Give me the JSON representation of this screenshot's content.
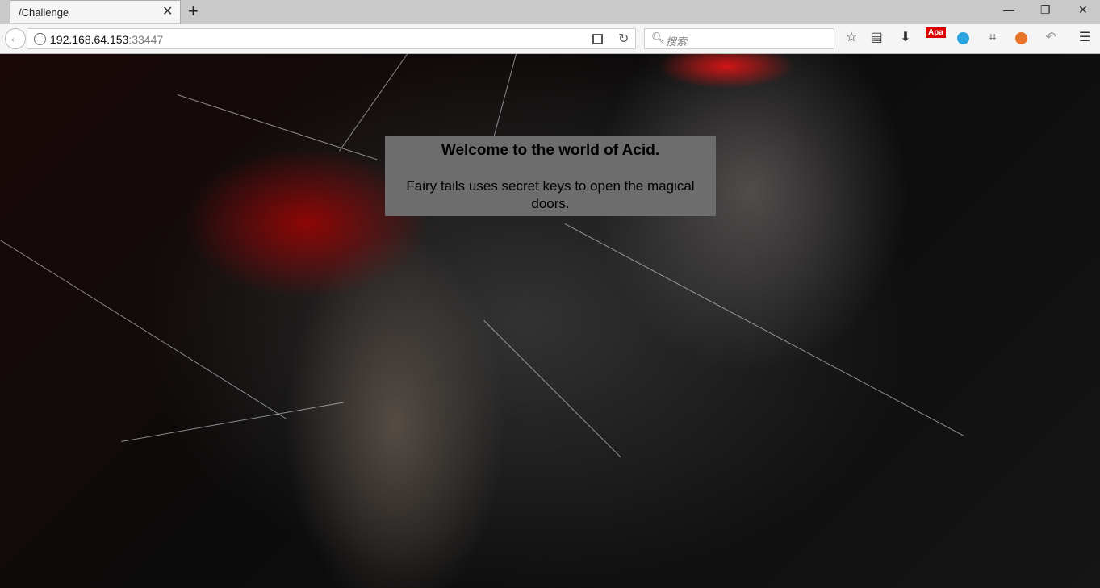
{
  "browser": {
    "tab": {
      "title": "/Challenge"
    },
    "address": {
      "host": "192.168.64.153",
      "port": ":33447"
    },
    "search": {
      "placeholder": "搜索"
    },
    "extension_badge": "Apa"
  },
  "page": {
    "title": "Welcome to the world of Acid.",
    "text": "Fairy tails uses secret keys to open the magical doors."
  }
}
